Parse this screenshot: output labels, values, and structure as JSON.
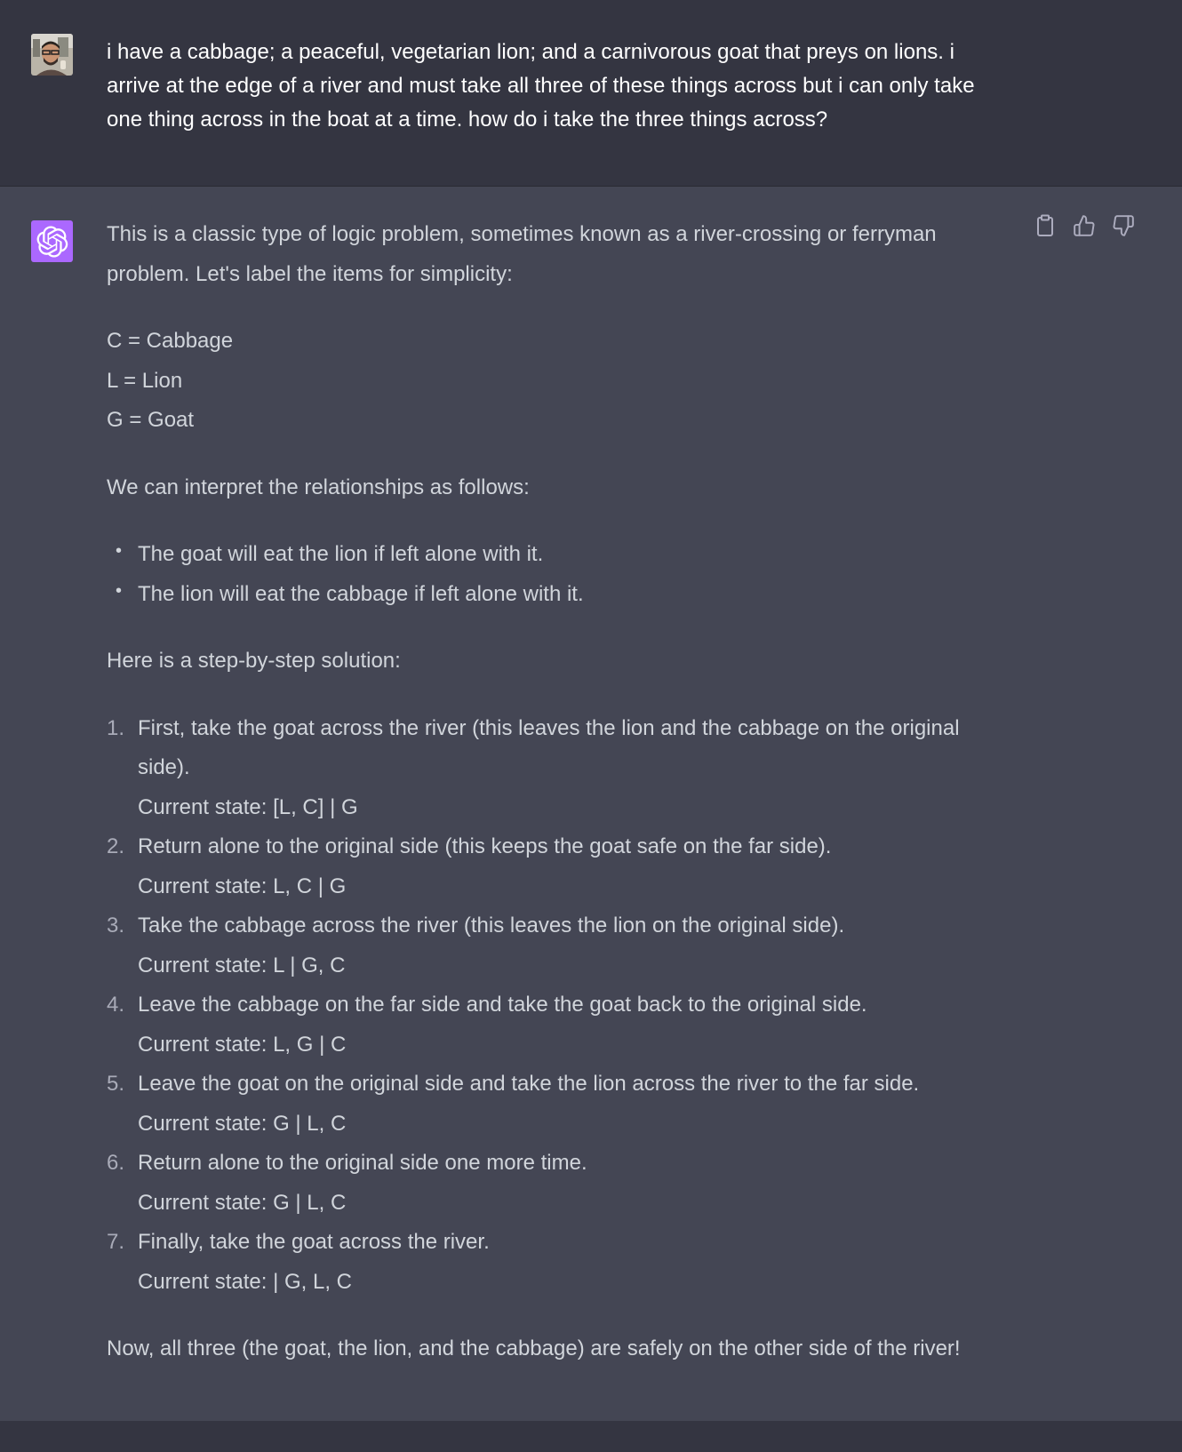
{
  "user": {
    "message": "i have a cabbage; a peaceful, vegetarian lion; and a carnivorous goat that preys on lions. i arrive at the edge of a river and must take all three of these things across but i can only take one thing across in the boat at a time. how do i take the three things across?"
  },
  "assistant": {
    "intro": "This is a classic type of logic problem, sometimes known as a river-crossing or ferryman problem. Let's label the items for simplicity:",
    "labels": [
      "C = Cabbage",
      "L = Lion",
      "G = Goat"
    ],
    "relationships_intro": "We can interpret the relationships as follows:",
    "bullets": [
      "The goat will eat the lion if left alone with it.",
      "The lion will eat the cabbage if left alone with it."
    ],
    "solution_intro": "Here is a step-by-step solution:",
    "steps": [
      {
        "num": "1.",
        "text": "First, take the goat across the river (this leaves the lion and the cabbage on the original side).",
        "state": "Current state: [L, C] | G"
      },
      {
        "num": "2.",
        "text": "Return alone to the original side (this keeps the goat safe on the far side).",
        "state": "Current state: L, C | G"
      },
      {
        "num": "3.",
        "text": "Take the cabbage across the river (this leaves the lion on the original side).",
        "state": "Current state: L | G, C"
      },
      {
        "num": "4.",
        "text": "Leave the cabbage on the far side and take the goat back to the original side.",
        "state": "Current state: L, G | C"
      },
      {
        "num": "5.",
        "text": "Leave the goat on the original side and take the lion across the river to the far side.",
        "state": "Current state: G | L, C"
      },
      {
        "num": "6.",
        "text": "Return alone to the original side one more time.",
        "state": "Current state: G | L, C"
      },
      {
        "num": "7.",
        "text": "Finally, take the goat across the river.",
        "state": "Current state: | G, L, C"
      }
    ],
    "conclusion": "Now, all three (the goat, the lion, and the cabbage) are safely on the other side of the river!"
  },
  "icons": {
    "copy": "clipboard-icon",
    "like": "thumbs-up-icon",
    "dislike": "thumbs-down-icon",
    "bot": "openai-logo-icon"
  },
  "colors": {
    "background": "#343541",
    "assistant_background": "#444654",
    "bot_avatar": "#ab68ff",
    "text": "#d1d5db"
  }
}
